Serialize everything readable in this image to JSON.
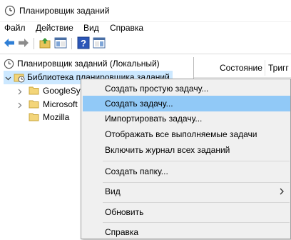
{
  "window": {
    "title": "Планировщик заданий"
  },
  "menu": {
    "file": "Файл",
    "action": "Действие",
    "view": "Вид",
    "help": "Справка"
  },
  "toolbar": {
    "back": "arrow-left-icon",
    "forward": "arrow-right-icon",
    "up": "folder-up-icon",
    "show_hide": "console-tree-icon",
    "help": "help-icon",
    "action_pane": "action-pane-icon"
  },
  "tree": {
    "root": "Планировщик заданий (Локальный)",
    "library": "Библиотека планировщика заданий",
    "folders": [
      "GoogleSystem",
      "Microsoft",
      "Mozilla"
    ]
  },
  "columns": [
    "Состояние",
    "Тригг"
  ],
  "context_menu": {
    "items": [
      "Создать простую задачу...",
      "Создать задачу...",
      "Импортировать задачу...",
      "Отображать все выполняемые задачи",
      "Включить журнал всех заданий",
      "Создать папку...",
      "Вид",
      "Обновить",
      "Справка"
    ],
    "highlighted_index": 1
  },
  "colors": {
    "selection": "#cce8ff",
    "highlight": "#91c9f7",
    "menu_bg": "#f0f0f0"
  }
}
